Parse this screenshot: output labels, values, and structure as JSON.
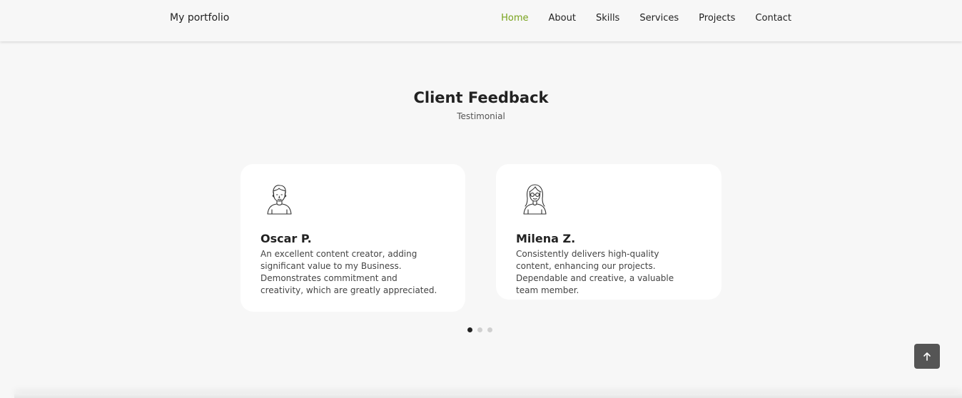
{
  "header": {
    "logo": "My portfolio",
    "nav": [
      {
        "label": "Home",
        "active": true
      },
      {
        "label": "About",
        "active": false
      },
      {
        "label": "Skills",
        "active": false
      },
      {
        "label": "Services",
        "active": false
      },
      {
        "label": "Projects",
        "active": false
      },
      {
        "label": "Contact",
        "active": false
      }
    ],
    "active_color": "#79a31d"
  },
  "testimonials": {
    "title": "Client Feedback",
    "subtitle": "Testimonial",
    "cards": [
      {
        "name": "Oscar P.",
        "text": "An excellent content creator, adding significant value to my Business. Demonstrates commitment and creativity, which are greatly appreciated.",
        "avatar_icon": "man-avatar-icon"
      },
      {
        "name": "Milena Z.",
        "text": "Consistently delivers high-quality content, enhancing our projects. Dependable and creative, a valuable team member.",
        "avatar_icon": "woman-avatar-icon"
      }
    ],
    "pagination": {
      "total": 3,
      "active_index": 0
    }
  },
  "scroll_top": {
    "icon": "arrow-up-icon"
  }
}
